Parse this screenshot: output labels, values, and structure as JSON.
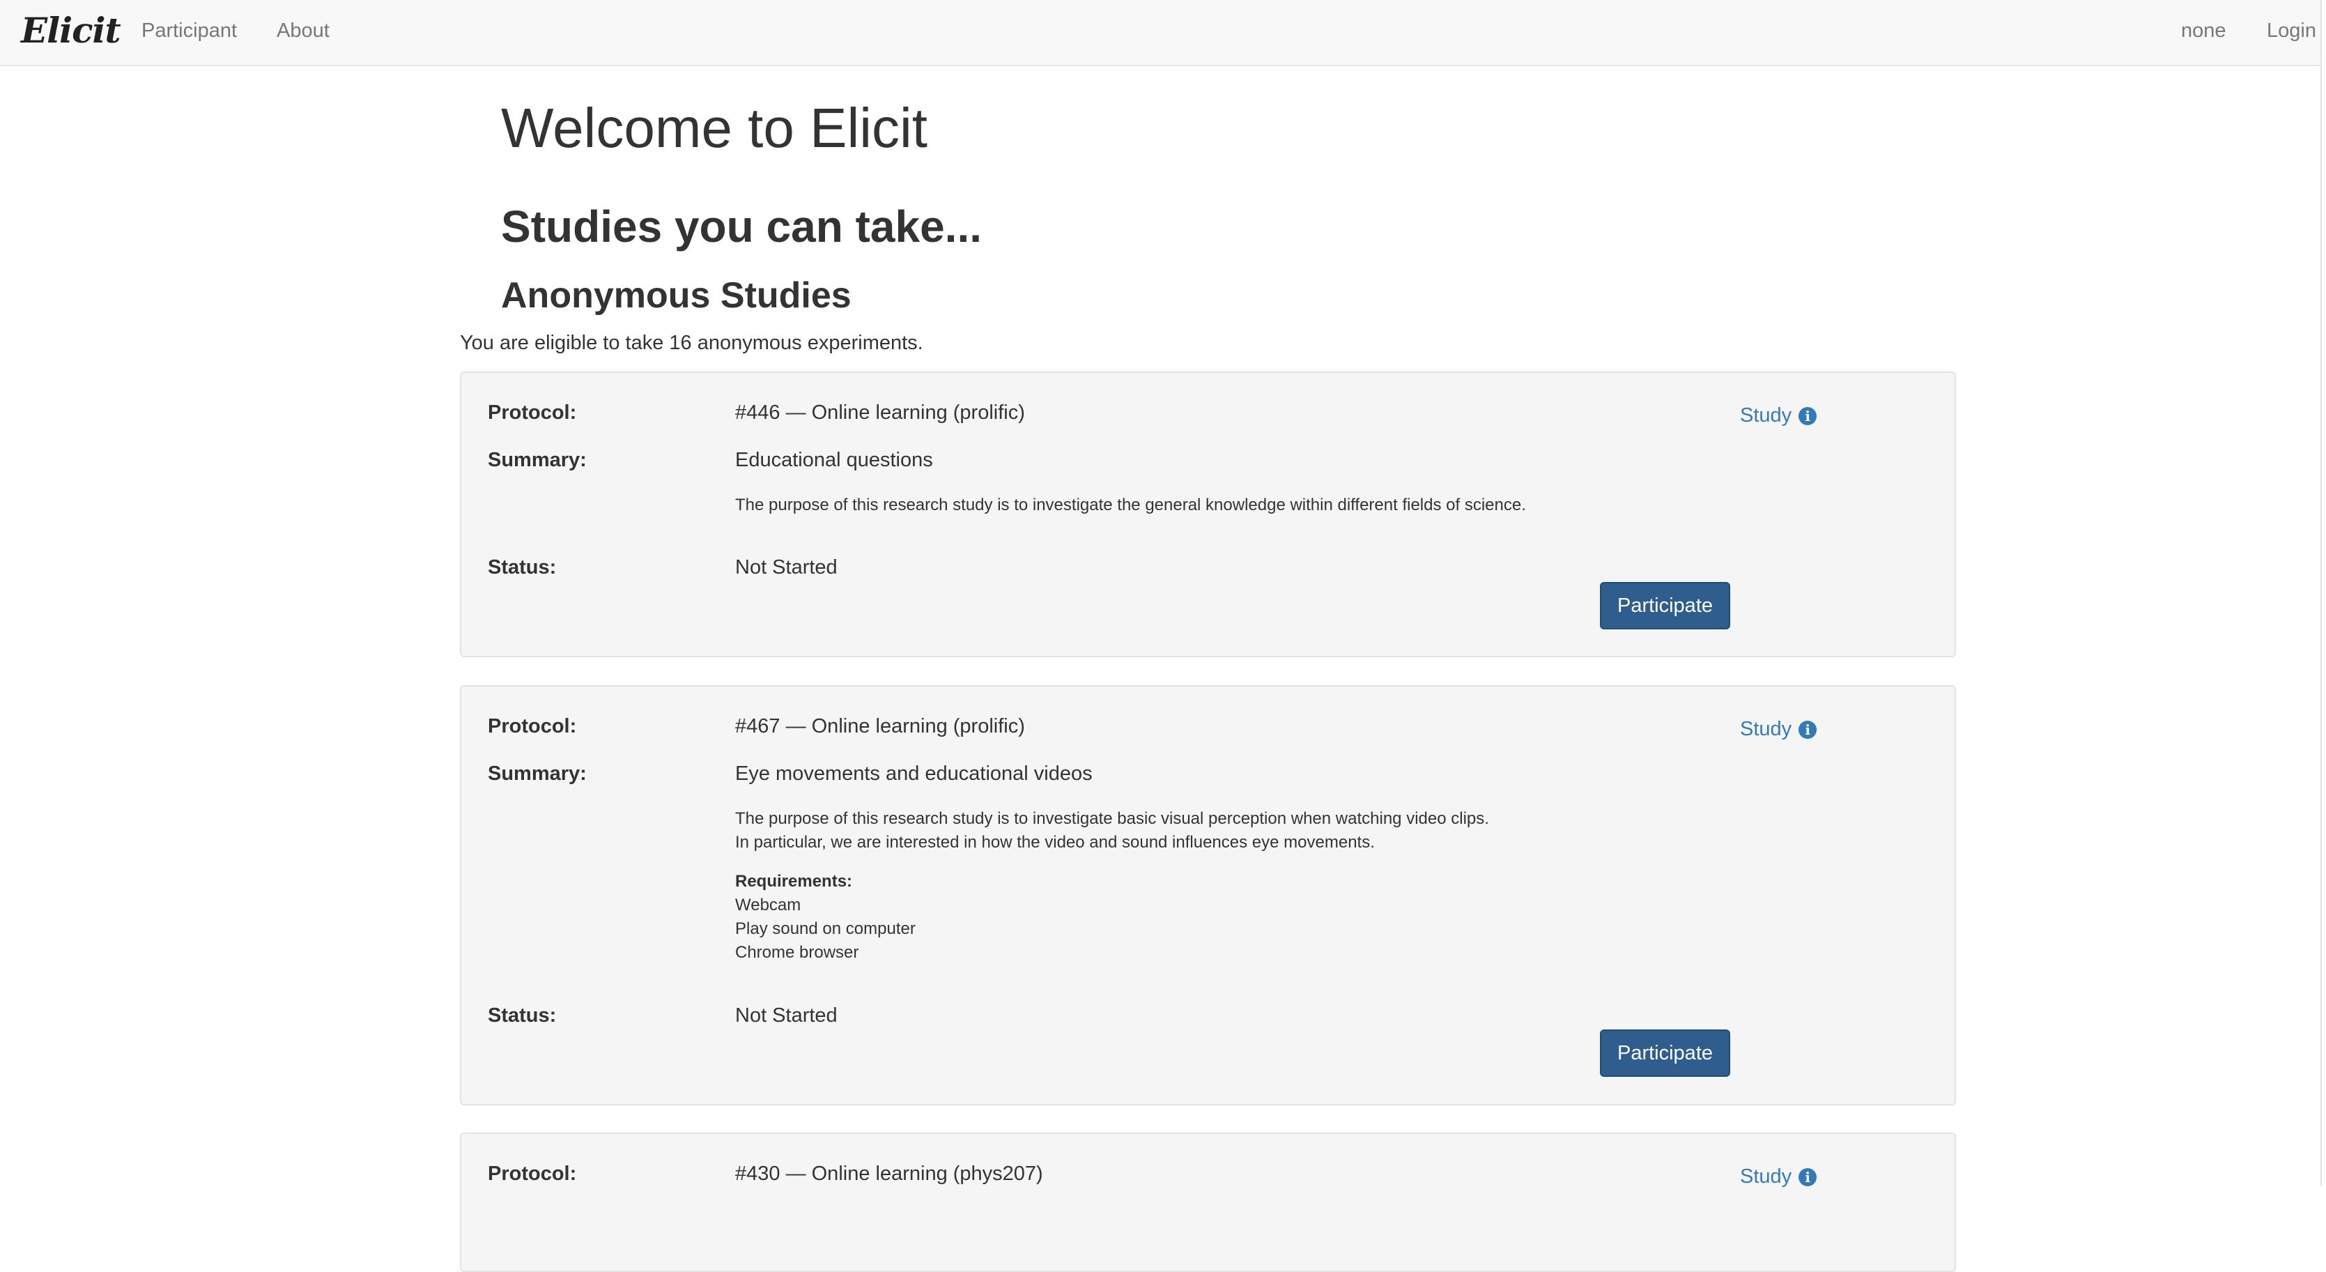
{
  "nav": {
    "brand": "Elicit",
    "links": [
      "Participant",
      "About"
    ],
    "user": "none",
    "login": "Login"
  },
  "headings": {
    "welcome": "Welcome to Elicit",
    "studies": "Studies you can take...",
    "anonymous": "Anonymous Studies"
  },
  "eligibility": "You are eligible to take 16 anonymous experiments.",
  "labels": {
    "protocol": "Protocol:",
    "summary": "Summary:",
    "status": "Status:",
    "requirements": "Requirements:",
    "study_link": "Study",
    "participate": "Participate"
  },
  "studies": [
    {
      "protocol": "#446 — Online learning (prolific)",
      "summary": "Educational questions",
      "description": [
        "The purpose of this research study is to investigate the general knowledge within different fields of science."
      ],
      "status": "Not Started"
    },
    {
      "protocol": "#467 — Online learning (prolific)",
      "summary": "Eye movements and educational videos",
      "description": [
        "The purpose of this research study is to investigate basic visual perception when watching video clips.",
        "In particular, we are interested in how the video and sound influences eye movements."
      ],
      "requirements": [
        "Webcam",
        "Play sound on computer",
        "Chrome browser"
      ],
      "status": "Not Started"
    },
    {
      "protocol": "#430 — Online learning (phys207)"
    }
  ],
  "colors": {
    "link": "#337ab7",
    "button": "#2e5d8e",
    "card_bg": "#f5f5f5",
    "navbar_bg": "#f8f8f8"
  },
  "icons": [
    "info-circle-icon"
  ]
}
